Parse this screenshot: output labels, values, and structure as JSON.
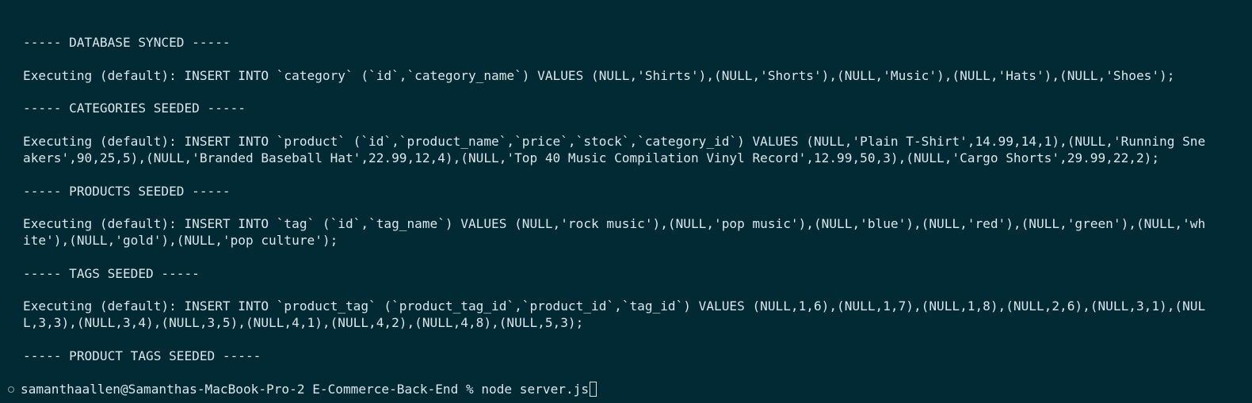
{
  "terminal": {
    "lines": [
      "----- DATABASE SYNCED -----",
      "Executing (default): INSERT INTO `category` (`id`,`category_name`) VALUES (NULL,'Shirts'),(NULL,'Shorts'),(NULL,'Music'),(NULL,'Hats'),(NULL,'Shoes');",
      "----- CATEGORIES SEEDED -----",
      "Executing (default): INSERT INTO `product` (`id`,`product_name`,`price`,`stock`,`category_id`) VALUES (NULL,'Plain T-Shirt',14.99,14,1),(NULL,'Running Sne",
      "akers',90,25,5),(NULL,'Branded Baseball Hat',22.99,12,4),(NULL,'Top 40 Music Compilation Vinyl Record',12.99,50,3),(NULL,'Cargo Shorts',29.99,22,2);",
      "----- PRODUCTS SEEDED -----",
      "Executing (default): INSERT INTO `tag` (`id`,`tag_name`) VALUES (NULL,'rock music'),(NULL,'pop music'),(NULL,'blue'),(NULL,'red'),(NULL,'green'),(NULL,'wh",
      "ite'),(NULL,'gold'),(NULL,'pop culture');",
      "----- TAGS SEEDED -----",
      "Executing (default): INSERT INTO `product_tag` (`product_tag_id`,`product_id`,`tag_id`) VALUES (NULL,1,6),(NULL,1,7),(NULL,1,8),(NULL,2,6),(NULL,3,1),(NUL",
      "L,3,3),(NULL,3,4),(NULL,3,5),(NULL,4,1),(NULL,4,2),(NULL,4,8),(NULL,5,3);",
      "----- PRODUCT TAGS SEEDED -----"
    ],
    "prompt": {
      "text": "samanthaallen@Samanthas-MacBook-Pro-2 E-Commerce-Back-End % ",
      "command": "node server.js"
    },
    "colors": {
      "background": "#012a35",
      "foreground": "#dbe6ea"
    }
  }
}
